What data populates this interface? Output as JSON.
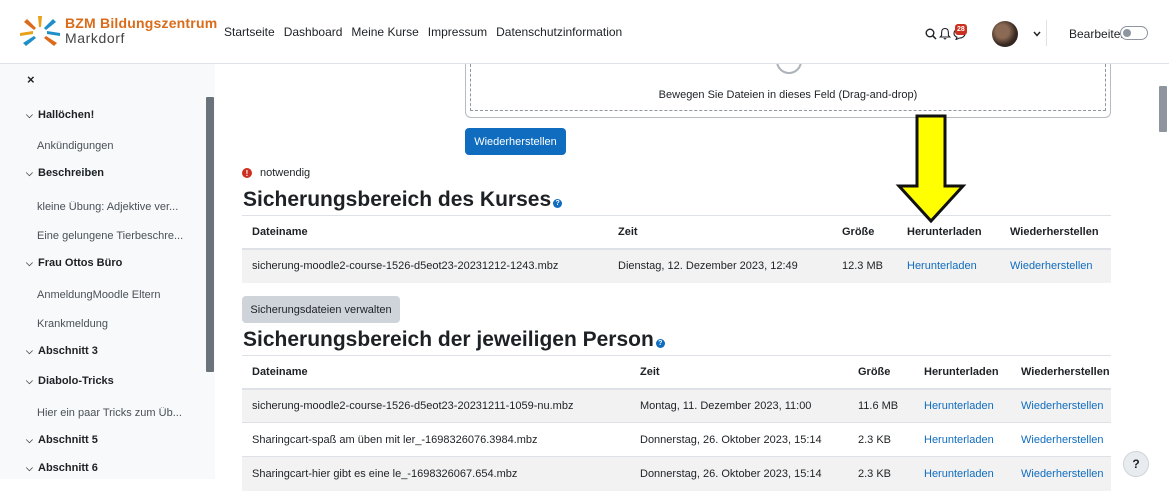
{
  "brand": {
    "line1": "BZM Bildungszentrum",
    "line2": "Markdorf"
  },
  "nav": {
    "links": [
      "Startseite",
      "Dashboard",
      "Meine Kurse",
      "Impressum",
      "Datenschutzinformation"
    ]
  },
  "header_right": {
    "notification_count": "28",
    "edit_label": "Bearbeiten"
  },
  "drawer": {
    "close_symbol": "×",
    "items": [
      {
        "type": "section",
        "label": "Hallöchen!"
      },
      {
        "type": "link",
        "label": "Ankündigungen"
      },
      {
        "type": "section",
        "label": "Beschreiben"
      },
      {
        "type": "link",
        "label": "kleine Übung: Adjektive ver..."
      },
      {
        "type": "link",
        "label": "Eine gelungene Tierbeschre..."
      },
      {
        "type": "section",
        "label": "Frau Ottos Büro"
      },
      {
        "type": "link",
        "label": "AnmeldungMoodle Eltern"
      },
      {
        "type": "link",
        "label": "Krankmeldung"
      },
      {
        "type": "section",
        "label": "Abschnitt 3"
      },
      {
        "type": "section",
        "label": "Diabolo-Tricks"
      },
      {
        "type": "link",
        "label": "Hier ein paar Tricks zum Üb..."
      },
      {
        "type": "section",
        "label": "Abschnitt 5"
      },
      {
        "type": "section",
        "label": "Abschnitt 6"
      }
    ]
  },
  "dropzone": {
    "text": "Bewegen Sie Dateien in dieses Feld (Drag-and-drop)"
  },
  "restore_button": "Wiederherstellen",
  "required_label": "notwendig",
  "course_backup": {
    "heading": "Sicherungsbereich des Kurses",
    "columns": [
      "Dateiname",
      "Zeit",
      "Größe",
      "Herunterladen",
      "Wiederherstellen"
    ],
    "rows": [
      {
        "file": "sicherung-moodle2-course-1526-d5eot23-20231212-1243.mbz",
        "time": "Dienstag, 12. Dezember 2023, 12:49",
        "size": "12.3 MB",
        "download": "Herunterladen",
        "restore": "Wiederherstellen"
      }
    ]
  },
  "manage_button": "Sicherungsdateien verwalten",
  "user_backup": {
    "heading": "Sicherungsbereich der jeweiligen Person",
    "columns": [
      "Dateiname",
      "Zeit",
      "Größe",
      "Herunterladen",
      "Wiederherstellen"
    ],
    "rows": [
      {
        "file": "sicherung-moodle2-course-1526-d5eot23-20231211-1059-nu.mbz",
        "time": "Montag, 11. Dezember 2023, 11:00",
        "size": "11.6 MB",
        "download": "Herunterladen",
        "restore": "Wiederherstellen"
      },
      {
        "file": "Sharingcart-spaß am üben mit ler_-1698326076.3984.mbz",
        "time": "Donnerstag, 26. Oktober 2023, 15:14",
        "size": "2.3 KB",
        "download": "Herunterladen",
        "restore": "Wiederherstellen"
      },
      {
        "file": "Sharingcart-hier gibt es eine le_-1698326067.654.mbz",
        "time": "Donnerstag, 26. Oktober 2023, 15:14",
        "size": "2.3 KB",
        "download": "Herunterladen",
        "restore": "Wiederherstellen"
      }
    ]
  },
  "help_fab": "?",
  "colors": {
    "primary": "#0f6cbf",
    "brand_orange": "#d96b1a",
    "annotation_arrow": "#ffff00",
    "badge": "#ca3120"
  }
}
